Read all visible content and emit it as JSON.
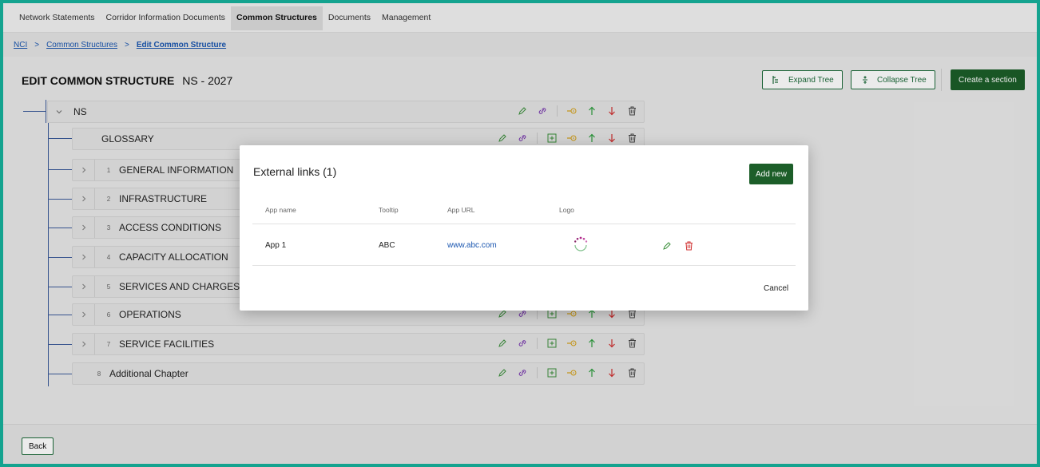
{
  "nav": {
    "tabs": [
      {
        "label": "Network Statements"
      },
      {
        "label": "Corridor Information Documents"
      },
      {
        "label": "Common Structures"
      },
      {
        "label": "Documents"
      },
      {
        "label": "Management"
      }
    ],
    "active_index": 2
  },
  "breadcrumb": {
    "items": [
      "NCI",
      "Common Structures",
      "Edit Common Structure"
    ],
    "separator": ">"
  },
  "header": {
    "title": "EDIT COMMON STRUCTURE",
    "code": "NS - 2027",
    "expand_label": "Expand Tree",
    "collapse_label": "Collapse Tree",
    "create_label": "Create a section"
  },
  "tree": {
    "root": {
      "label": "NS"
    },
    "items": [
      {
        "num": "",
        "label": "GLOSSARY",
        "expandable": false
      },
      {
        "num": "1",
        "label": "GENERAL INFORMATION",
        "expandable": true
      },
      {
        "num": "2",
        "label": "INFRASTRUCTURE",
        "expandable": true
      },
      {
        "num": "3",
        "label": "ACCESS CONDITIONS",
        "expandable": true
      },
      {
        "num": "4",
        "label": "CAPACITY ALLOCATION",
        "expandable": true
      },
      {
        "num": "5",
        "label": "SERVICES AND CHARGES",
        "expandable": true
      },
      {
        "num": "6",
        "label": "OPERATIONS",
        "expandable": true
      },
      {
        "num": "7",
        "label": "SERVICE FACILITIES",
        "expandable": true
      },
      {
        "num": "8",
        "label": "Additional Chapter",
        "expandable": false
      }
    ]
  },
  "footer": {
    "back_label": "Back"
  },
  "modal": {
    "title": "External links (1)",
    "add_label": "Add new",
    "columns": [
      "App name",
      "Tooltip",
      "App URL",
      "Logo"
    ],
    "rows": [
      {
        "app_name": "App 1",
        "tooltip": "ABC",
        "url": "www.abc.com",
        "logo": "spinner-logo"
      }
    ],
    "cancel_label": "Cancel"
  },
  "colors": {
    "border": "#14a38f",
    "primary": "#1c5e29",
    "link": "#1a56b0",
    "edit": "#3a8f3a",
    "link_icon": "#7a3ab0",
    "move_icon": "#d4a017",
    "up": "#2e9e3e",
    "down": "#d03030",
    "delete": "#444444"
  },
  "icons": [
    "edit-icon",
    "link-icon",
    "add-child-icon",
    "move-icon",
    "arrow-up-icon",
    "arrow-down-icon",
    "delete-icon",
    "chevron-right-icon",
    "chevron-down-icon",
    "expand-tree-icon",
    "collapse-tree-icon"
  ]
}
